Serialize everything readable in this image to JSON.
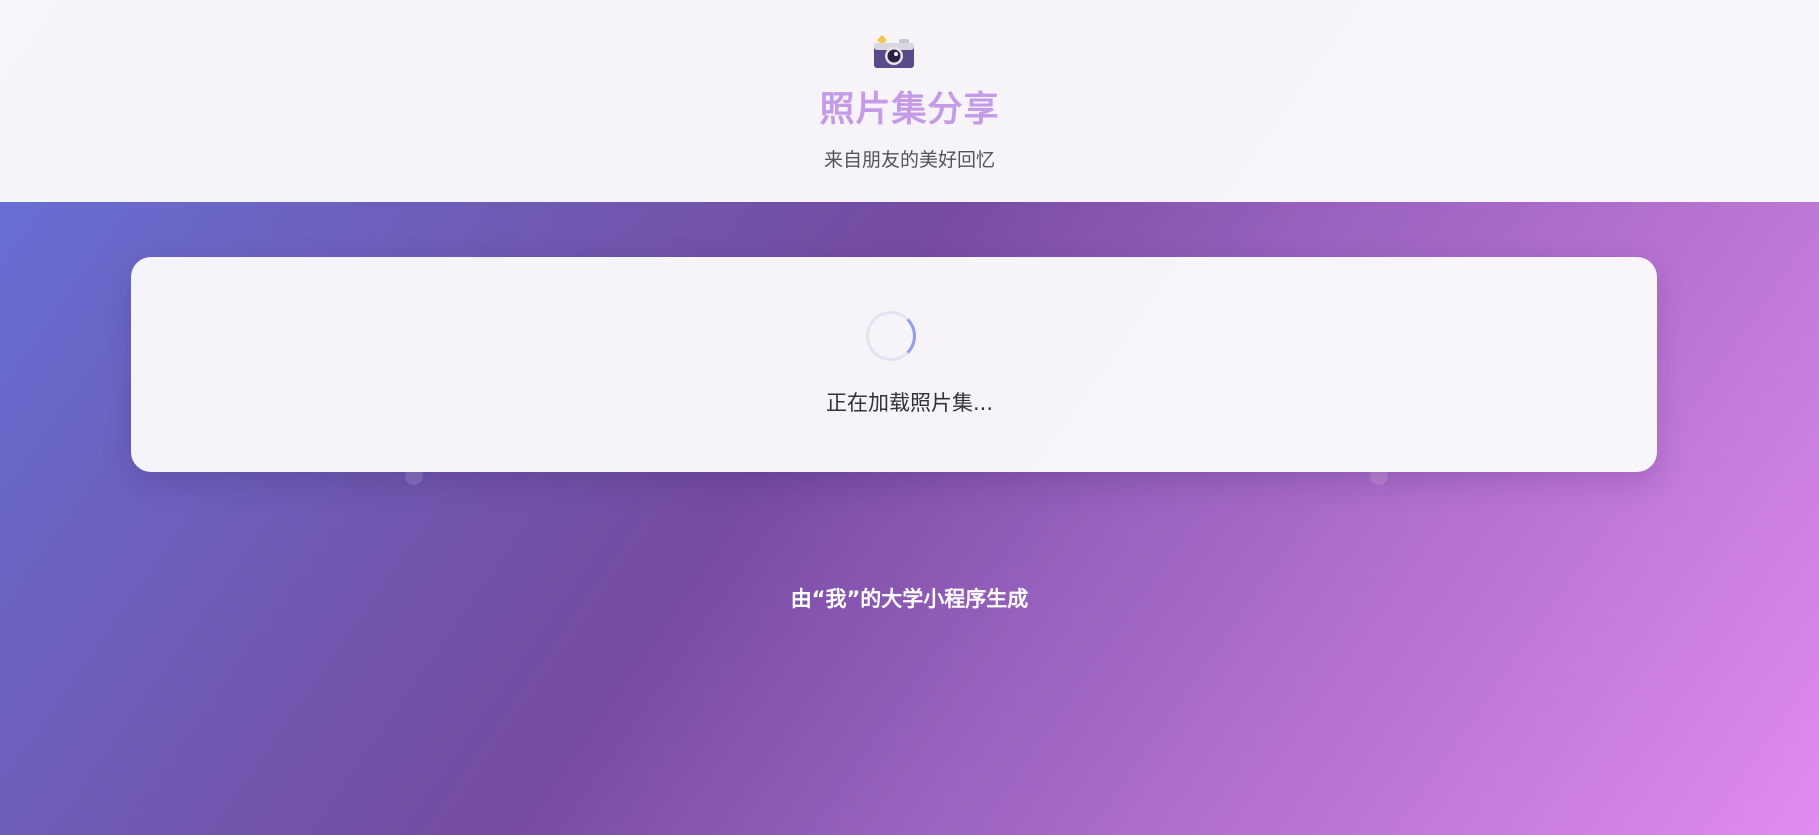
{
  "header": {
    "logo_icon": "camera-with-flash-icon",
    "title": "照片集分享",
    "subtitle": "来自朋友的美好回忆"
  },
  "loading": {
    "spinner_icon": "loading-spinner-icon",
    "text": "正在加载照片集..."
  },
  "footer": {
    "text": "由“我”的大学小程序生成"
  },
  "colors": {
    "title": "#c59be8",
    "gradient_start": "#667eea",
    "gradient_mid": "#764ba2",
    "gradient_end": "#e08cee",
    "spinner_accent": "#8fa0e8"
  }
}
